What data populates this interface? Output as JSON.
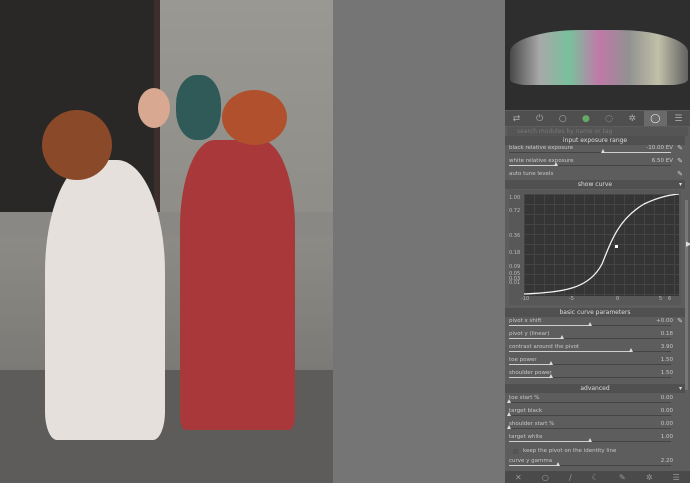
{
  "modules_tabs": [
    {
      "icon": "presets-icon",
      "glyph": "⇄"
    },
    {
      "icon": "power-icon",
      "glyph": "⏻"
    },
    {
      "icon": "circle-icon",
      "glyph": "○"
    },
    {
      "icon": "color-icon",
      "glyph": "●"
    },
    {
      "icon": "correct-icon",
      "glyph": "◌"
    },
    {
      "icon": "effects-icon",
      "glyph": "✲"
    },
    {
      "icon": "active-module-icon",
      "glyph": "◯"
    },
    {
      "icon": "menu-icon",
      "glyph": "☰"
    }
  ],
  "search": {
    "placeholder": "search modules by name or tag"
  },
  "input_exposure": {
    "title": "input exposure range",
    "black": {
      "label": "black relative exposure",
      "value": "-10.00 EV",
      "fraction": 0.58
    },
    "white": {
      "label": "white relative exposure",
      "value": "6.50 EV",
      "fraction": 0.29
    },
    "auto": {
      "label": "auto tune levels"
    }
  },
  "show_curve": {
    "title": "show curve",
    "arrow": "▾",
    "y_ticks": [
      "1.00",
      "0.72",
      "0.36",
      "0.18",
      "0.09",
      "0.05",
      "0.03",
      "0.01"
    ],
    "x_ticks": [
      "-10",
      "-5",
      "0",
      "5",
      "6"
    ]
  },
  "basic": {
    "title": "basic curve parameters",
    "rows": [
      {
        "label": "pivot x shift",
        "value": "+0.00",
        "fraction": 0.5
      },
      {
        "label": "pivot y (linear)",
        "value": "0.18",
        "fraction": 0.33
      },
      {
        "label": "contrast around the pivot",
        "value": "3.90",
        "fraction": 0.75
      },
      {
        "label": "toe power",
        "value": "1.50",
        "fraction": 0.26
      },
      {
        "label": "shoulder power",
        "value": "1.50",
        "fraction": 0.26
      }
    ]
  },
  "advanced": {
    "title": "advanced",
    "arrow": "▾",
    "rows": [
      {
        "label": "toe start %",
        "value": "0.00",
        "fraction": 0
      },
      {
        "label": "target black",
        "value": "0.00",
        "fraction": 0
      },
      {
        "label": "shoulder start %",
        "value": "0.00",
        "fraction": 0
      },
      {
        "label": "target white",
        "value": "1.00",
        "fraction": 0.5
      }
    ],
    "checkbox": {
      "label": "keep the pivot on the identity line",
      "checked": false
    },
    "gamma": {
      "label": "curve y gamma",
      "value": "2.20",
      "fraction": 0.3
    }
  },
  "bottom_icons": [
    {
      "icon": "reset-icon",
      "glyph": "✕"
    },
    {
      "icon": "circle-icon",
      "glyph": "○"
    },
    {
      "icon": "brush-icon",
      "glyph": "∕"
    },
    {
      "icon": "moon-icon",
      "glyph": "☾"
    },
    {
      "icon": "pick-icon",
      "glyph": "✎"
    },
    {
      "icon": "styles-icon",
      "glyph": "✲"
    },
    {
      "icon": "more-icon",
      "glyph": "☰"
    }
  ]
}
